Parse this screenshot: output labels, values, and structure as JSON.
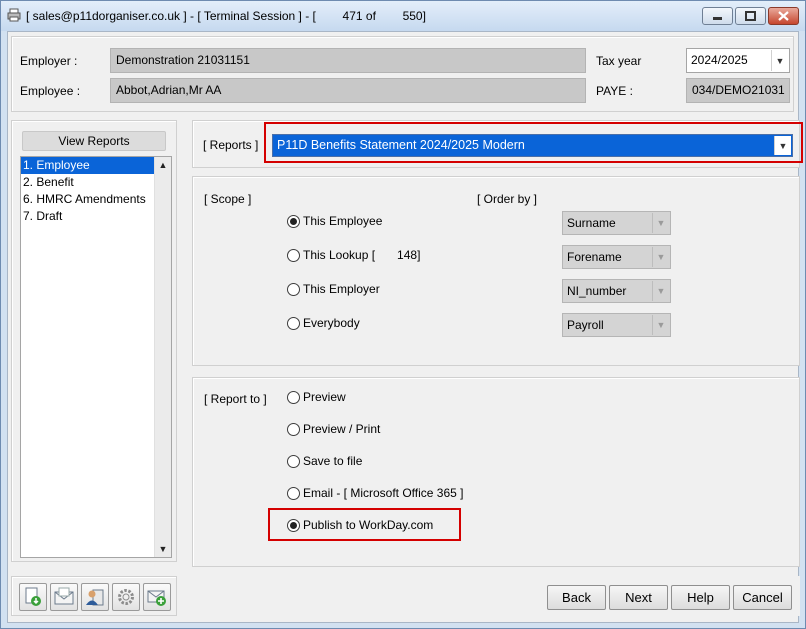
{
  "window": {
    "title": "[ sales@p11dorganiser.co.uk ] - [ Terminal Session ] - [        471 of        550]"
  },
  "header": {
    "employer_label": "Employer :",
    "employer_value": "Demonstration 21031151",
    "employee_label": "Employee :",
    "employee_value": "Abbot,Adrian,Mr AA",
    "tax_year_label": "Tax year",
    "tax_year_value": "2024/2025",
    "paye_label": "PAYE :",
    "paye_value": "034/DEMO21031"
  },
  "sidebar": {
    "title": "View Reports",
    "items": [
      {
        "label": "1. Employee",
        "selected": true
      },
      {
        "label": "2. Benefit",
        "selected": false
      },
      {
        "label": "6. HMRC Amendments",
        "selected": false
      },
      {
        "label": "7. Draft",
        "selected": false
      }
    ]
  },
  "reports": {
    "label": "[ Reports ]",
    "selected": "P11D Benefits Statement 2024/2025 Modern"
  },
  "scope": {
    "label": "[ Scope ]",
    "options": [
      {
        "label": "This Employee",
        "checked": true
      },
      {
        "label": "This Lookup [",
        "checked": false,
        "count": "148]"
      },
      {
        "label": "This Employer",
        "checked": false
      },
      {
        "label": "Everybody",
        "checked": false
      }
    ],
    "order_label": "[ Order by ]",
    "order_fields": [
      "Surname",
      "Forename",
      "NI_number",
      "Payroll"
    ]
  },
  "report_to": {
    "label": "[ Report to ]",
    "options": [
      {
        "label": "Preview",
        "checked": false
      },
      {
        "label": "Preview / Print",
        "checked": false
      },
      {
        "label": "Save to file",
        "checked": false
      },
      {
        "label": "Email - [ Microsoft Office 365 ]",
        "checked": false
      },
      {
        "label": "Publish to WorkDay.com",
        "checked": true
      }
    ]
  },
  "footer": {
    "buttons": [
      "Back",
      "Next",
      "Help",
      "Cancel"
    ],
    "icon_buttons": [
      "import-document-icon",
      "email-letter-icon",
      "user-clipboard-icon",
      "settings-gear-icon",
      "add-email-icon"
    ]
  },
  "colors": {
    "selection": "#0a64d8",
    "highlight": "#d40000"
  }
}
